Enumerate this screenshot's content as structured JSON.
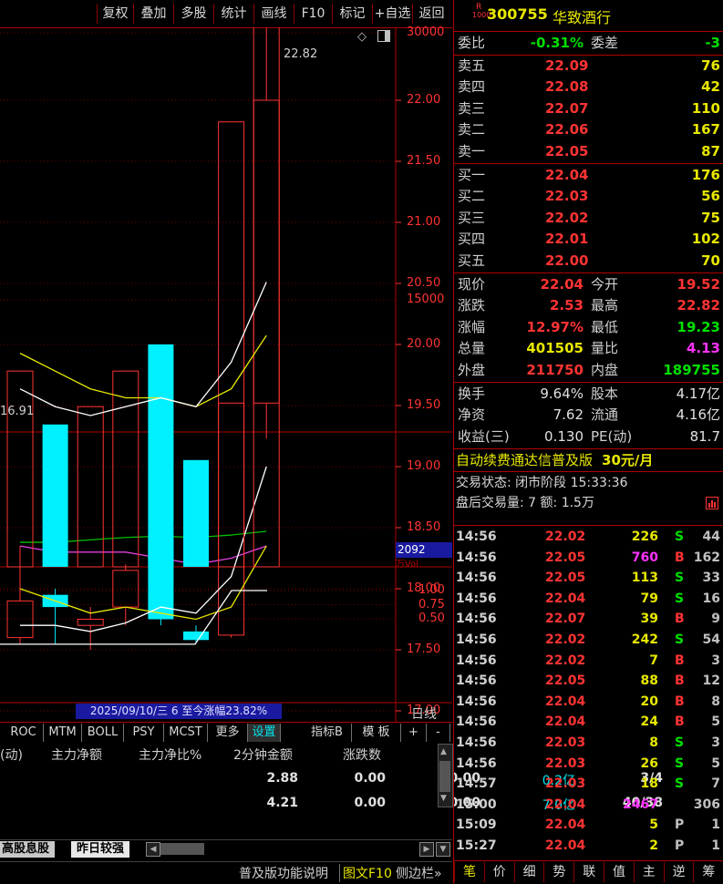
{
  "toolbar": {
    "buttons": [
      "复权",
      "叠加",
      "多股",
      "统计",
      "画线",
      "F10",
      "标记",
      "+自选",
      "返回"
    ]
  },
  "stock": {
    "badge_top": "R",
    "badge_bottom": "1000",
    "code": "300755",
    "name": "华致酒行"
  },
  "quote": {
    "weibi_label": "委比",
    "weibi_value": "-0.31%",
    "weicha_label": "委差",
    "weicha_value": "-3",
    "asks": [
      {
        "label": "卖五",
        "price": "22.09",
        "vol": "76"
      },
      {
        "label": "卖四",
        "price": "22.08",
        "vol": "42"
      },
      {
        "label": "卖三",
        "price": "22.07",
        "vol": "110"
      },
      {
        "label": "卖二",
        "price": "22.06",
        "vol": "167"
      },
      {
        "label": "卖一",
        "price": "22.05",
        "vol": "87"
      }
    ],
    "bids": [
      {
        "label": "买一",
        "price": "22.04",
        "vol": "176"
      },
      {
        "label": "买二",
        "price": "22.03",
        "vol": "56"
      },
      {
        "label": "买三",
        "price": "22.02",
        "vol": "75"
      },
      {
        "label": "买四",
        "price": "22.01",
        "vol": "102"
      },
      {
        "label": "买五",
        "price": "22.00",
        "vol": "70"
      }
    ],
    "stats": [
      {
        "l1": "现价",
        "v1": "22.04",
        "c1": "red",
        "l2": "今开",
        "v2": "19.52",
        "c2": "red"
      },
      {
        "l1": "涨跌",
        "v1": "2.53",
        "c1": "red",
        "l2": "最高",
        "v2": "22.82",
        "c2": "red"
      },
      {
        "l1": "涨幅",
        "v1": "12.97%",
        "c1": "red",
        "l2": "最低",
        "v2": "19.23",
        "c2": "green"
      },
      {
        "l1": "总量",
        "v1": "401505",
        "c1": "yellow",
        "l2": "量比",
        "v2": "4.13",
        "c2": "magenta"
      },
      {
        "l1": "外盘",
        "v1": "211750",
        "c1": "red",
        "l2": "内盘",
        "v2": "189755",
        "c2": "green"
      }
    ],
    "fundamentals": [
      {
        "l1": "换手",
        "v1": "9.64%",
        "l2": "股本",
        "v2": "4.17亿"
      },
      {
        "l1": "净资",
        "v1": "7.62",
        "l2": "流通",
        "v2": "4.16亿"
      },
      {
        "l1": "收益(三)",
        "v1": "0.130",
        "l2": "PE(动)",
        "v2": "81.7"
      }
    ],
    "promo": "自动续费通达信普及版",
    "promo_price": "30元/月",
    "trade_status": "交易状态: 闭市阶段 15:33:36",
    "after_hours": "盘后交易量: 7  额: 1.5万"
  },
  "ticks": [
    {
      "t": "14:56",
      "p": "22.02",
      "v": "226",
      "vc": "yellow",
      "s": "S",
      "sc": "green",
      "c": "44"
    },
    {
      "t": "14:56",
      "p": "22.05",
      "v": "760",
      "vc": "magenta",
      "s": "B",
      "sc": "red",
      "c": "162"
    },
    {
      "t": "14:56",
      "p": "22.05",
      "v": "113",
      "vc": "yellow",
      "s": "S",
      "sc": "green",
      "c": "33"
    },
    {
      "t": "14:56",
      "p": "22.04",
      "v": "79",
      "vc": "yellow",
      "s": "S",
      "sc": "green",
      "c": "16"
    },
    {
      "t": "14:56",
      "p": "22.07",
      "v": "39",
      "vc": "yellow",
      "s": "B",
      "sc": "red",
      "c": "9"
    },
    {
      "t": "14:56",
      "p": "22.02",
      "v": "242",
      "vc": "yellow",
      "s": "S",
      "sc": "green",
      "c": "54"
    },
    {
      "t": "14:56",
      "p": "22.02",
      "v": "7",
      "vc": "yellow",
      "s": "B",
      "sc": "red",
      "c": "3"
    },
    {
      "t": "14:56",
      "p": "22.05",
      "v": "88",
      "vc": "yellow",
      "s": "B",
      "sc": "red",
      "c": "12"
    },
    {
      "t": "14:56",
      "p": "22.04",
      "v": "20",
      "vc": "yellow",
      "s": "B",
      "sc": "red",
      "c": "8"
    },
    {
      "t": "14:56",
      "p": "22.04",
      "v": "24",
      "vc": "yellow",
      "s": "B",
      "sc": "red",
      "c": "5"
    },
    {
      "t": "14:56",
      "p": "22.03",
      "v": "8",
      "vc": "yellow",
      "s": "S",
      "sc": "green",
      "c": "3"
    },
    {
      "t": "14:56",
      "p": "22.03",
      "v": "26",
      "vc": "yellow",
      "s": "S",
      "sc": "green",
      "c": "5"
    },
    {
      "t": "14:57",
      "p": "22.03",
      "v": "18",
      "vc": "yellow",
      "s": "S",
      "sc": "green",
      "c": "7"
    },
    {
      "t": "15:00",
      "p": "22.04",
      "v": "2467",
      "vc": "magenta",
      "s": "",
      "sc": "green",
      "c": "306"
    },
    {
      "t": "15:09",
      "p": "22.04",
      "v": "5",
      "vc": "yellow",
      "s": "P",
      "sc": "grey",
      "c": "1"
    },
    {
      "t": "15:27",
      "p": "22.04",
      "v": "2",
      "vc": "yellow",
      "s": "P",
      "sc": "grey",
      "c": "1"
    }
  ],
  "bottom_tabs": [
    "笔",
    "价",
    "细",
    "势",
    "联",
    "值",
    "主",
    "逆",
    "筹"
  ],
  "left_bottom": {
    "help": "普及版功能说明",
    "tuwen": "图文F10",
    "sidebar": "侧边栏»"
  },
  "price_axis": [
    "22.00",
    "21.50",
    "21.00",
    "20.50",
    "20.00",
    "19.50",
    "19.00",
    "18.50",
    "18.00",
    "17.50",
    "17.00"
  ],
  "high_label": "22.82",
  "low_label": "16.91",
  "volume_axis": [
    "30000",
    "15000"
  ],
  "volume_value": "2092",
  "volume_sub": "万Vol",
  "osc_axis": [
    "1.00",
    "0.75",
    "0.50"
  ],
  "date_banner": "2025/09/10/三 6 至今涨幅23.82%",
  "period": "日线",
  "indicators": [
    "ROC",
    "MTM",
    "BOLL",
    "PSY",
    "MCST",
    "更多",
    "设置"
  ],
  "indicator_right": [
    "指标B",
    "模 板",
    "+",
    "-"
  ],
  "table": {
    "headers": [
      "(动)",
      "主力净额",
      "主力净比%",
      "2分钟金额",
      "涨跌数"
    ],
    "rows": [
      [
        "2.88",
        "0.00",
        "0.00",
        "0.2亿",
        "3/4"
      ],
      [
        "4.21",
        "0.00",
        "0.00",
        "7.0亿",
        "40/38"
      ]
    ]
  },
  "sheet_tabs": [
    "高股息股",
    "昨日较强"
  ],
  "chart_data": {
    "type": "candlestick",
    "candles": [
      {
        "open": 17.9,
        "close": 17.6,
        "high": 18.35,
        "low": 17.55,
        "up": true
      },
      {
        "open": 17.95,
        "close": 17.85,
        "high": 18.0,
        "low": 17.55,
        "up": false
      },
      {
        "open": 17.7,
        "close": 17.75,
        "high": 17.85,
        "low": 17.5,
        "up": true
      },
      {
        "open": 17.85,
        "close": 18.15,
        "high": 18.2,
        "low": 17.7,
        "up": true
      },
      {
        "open": 18.4,
        "close": 17.75,
        "high": 18.5,
        "low": 17.7,
        "up": false
      },
      {
        "open": 17.65,
        "close": 17.58,
        "high": 17.7,
        "low": 17.55,
        "up": false
      },
      {
        "open": 17.62,
        "close": 19.52,
        "high": 19.52,
        "low": 17.6,
        "up": true
      },
      {
        "open": 19.52,
        "close": 22.0,
        "high": 22.82,
        "low": 19.23,
        "up": true
      }
    ],
    "ma_white": [
      17.7,
      17.7,
      17.65,
      17.72,
      17.85,
      17.8,
      18.1,
      19.0
    ],
    "ma_yellow": [
      18.0,
      17.9,
      17.8,
      17.85,
      17.8,
      17.75,
      17.85,
      18.35
    ],
    "ma_magenta": [
      18.35,
      18.3,
      18.3,
      18.3,
      18.25,
      18.2,
      18.25,
      18.35
    ],
    "ma_green": [
      18.38,
      18.38,
      18.4,
      18.42,
      18.43,
      18.42,
      18.44,
      18.47
    ],
    "volumes": [
      11000,
      8000,
      9000,
      11000,
      12500,
      6000,
      25000,
      48000
    ],
    "vol_up": [
      true,
      false,
      true,
      true,
      false,
      false,
      true,
      true
    ],
    "vol_ma_white": [
      10000,
      9000,
      8500,
      9000,
      9500,
      9000,
      11500,
      16000
    ],
    "vol_ma_yellow": [
      12000,
      11000,
      10000,
      9500,
      9500,
      9000,
      10000,
      13000
    ],
    "osc_line": [
      0.05,
      0.05,
      0.05,
      0.05,
      0.05,
      0.05,
      1.0,
      1.0
    ]
  }
}
